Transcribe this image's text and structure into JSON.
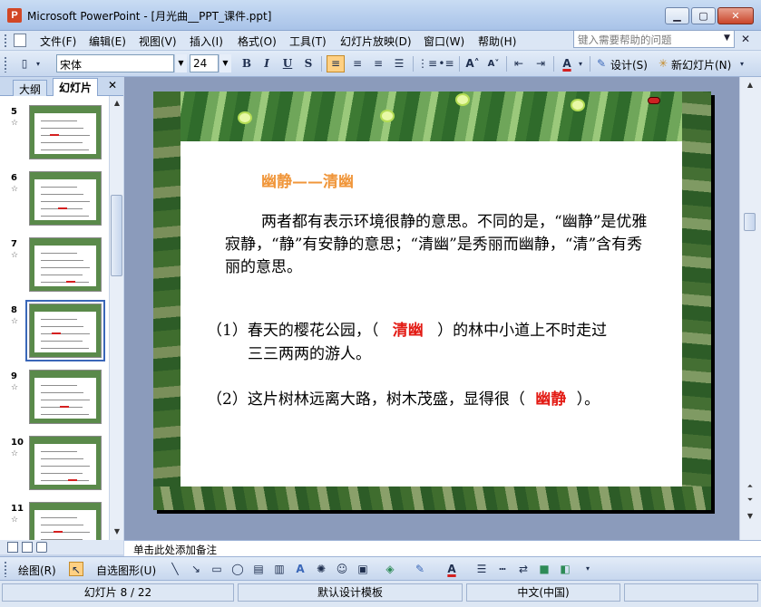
{
  "window": {
    "title": "Microsoft PowerPoint - [月光曲__PPT_课件.ppt]",
    "app_icon": "powerpoint-icon",
    "buttons": [
      "minimize",
      "maximize",
      "close"
    ]
  },
  "menu": {
    "items": [
      "文件(F)",
      "编辑(E)",
      "视图(V)",
      "插入(I)",
      "格式(O)",
      "工具(T)",
      "幻灯片放映(D)",
      "窗口(W)",
      "帮助(H)"
    ],
    "help_placeholder": "键入需要帮助的问题"
  },
  "toolbar": {
    "font_name": "宋体",
    "font_size": "24",
    "bold": "B",
    "italic": "I",
    "underline": "U",
    "shadow": "S",
    "design_label": "设计(S)",
    "new_slide_label": "新幻灯片(N)"
  },
  "left_pane": {
    "tabs": [
      "大纲",
      "幻灯片"
    ],
    "active_tab": "幻灯片",
    "thumbnails": [
      {
        "number": "5"
      },
      {
        "number": "6"
      },
      {
        "number": "7"
      },
      {
        "number": "8",
        "selected": true
      },
      {
        "number": "9"
      },
      {
        "number": "10"
      },
      {
        "number": "11"
      }
    ]
  },
  "slide": {
    "title": "幽静——清幽",
    "paragraph": "两者都有表示环境很静的意思。不同的是，“幽静”是优雅寂静，“静”有安静的意思；“清幽”是秀丽而幽静，“清”含有秀丽的意思。",
    "q1_before": "（1）春天的樱花公园，（",
    "q1_answer": "清幽",
    "q1_after": "）的林中小道上不时走过",
    "q1_line2": "三三两两的游人。",
    "q2_before": "（2）这片树林远离大路，树木茂盛，显得很（",
    "q2_answer": "幽静",
    "q2_after": "）。"
  },
  "notes": {
    "placeholder": "单击此处添加备注"
  },
  "draw_toolbar": {
    "draw_label": "绘图(R)",
    "autoshape_label": "自选图形(U)"
  },
  "status": {
    "slide_info": "幻灯片 8 / 22",
    "template": "默认设计模板",
    "language": "中文(中国)"
  },
  "colors": {
    "title_orange": "#f0963a",
    "answer_red": "#e31b14",
    "selection_blue": "#3a67b8"
  }
}
